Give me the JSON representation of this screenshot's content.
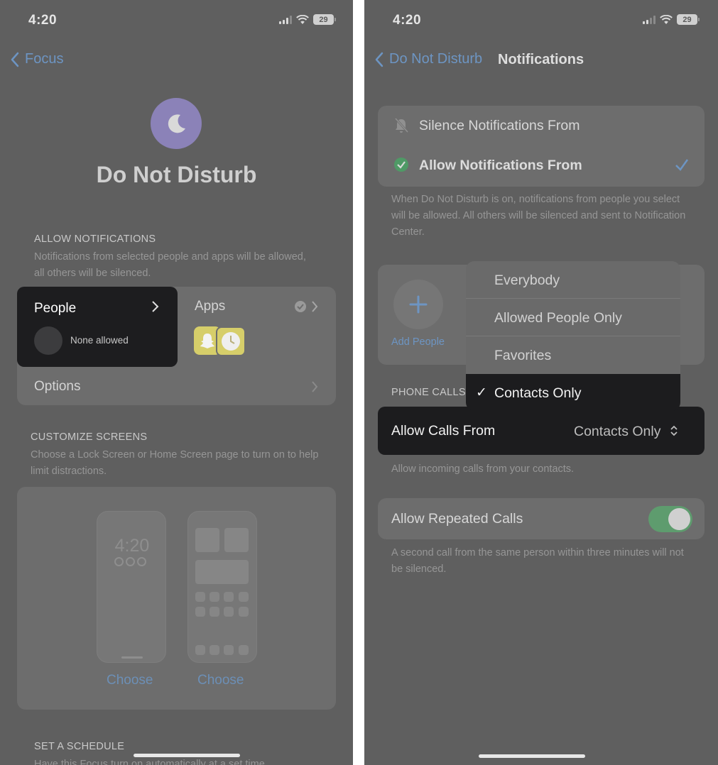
{
  "left": {
    "status": {
      "time": "4:20",
      "battery": "29"
    },
    "nav": {
      "back_label": "Focus"
    },
    "focus_title": "Do Not Disturb",
    "allow_notifications": {
      "header": "ALLOW NOTIFICATIONS",
      "description": "Notifications from selected people and apps will be allowed, all others will be silenced.",
      "people_label": "People",
      "people_status": "None allowed",
      "apps_label": "Apps",
      "options_label": "Options"
    },
    "customize_screens": {
      "header": "CUSTOMIZE SCREENS",
      "description": "Choose a Lock Screen or Home Screen page to turn on to help limit distractions.",
      "lock_preview_time": "4:20",
      "choose_lock": "Choose",
      "choose_home": "Choose"
    },
    "schedule": {
      "header": "SET A SCHEDULE",
      "description": "Have this Focus turn on automatically at a set time"
    }
  },
  "right": {
    "status": {
      "time": "4:20",
      "battery": "29"
    },
    "nav": {
      "back_label": "Do Not Disturb",
      "title": "Notifications"
    },
    "mode": {
      "silence_label": "Silence Notifications From",
      "allow_label": "Allow Notifications From",
      "description": "When Do Not Disturb is on, notifications from people you select will be allowed. All others will be silenced and sent to Notification Center."
    },
    "add_people_label": "Add People",
    "dropdown": {
      "options": [
        "Everybody",
        "Allowed People Only",
        "Favorites"
      ],
      "selected": "Contacts Only",
      "check": "✓"
    },
    "phone_calls": {
      "header": "PHONE CALLS",
      "allow_calls_label": "Allow Calls From",
      "allow_calls_value": "Contacts Only",
      "description": "Allow incoming calls from your contacts."
    },
    "repeated_calls": {
      "label": "Allow Repeated Calls",
      "enabled": true,
      "description": "A second call from the same person within three minutes will not be silenced."
    }
  },
  "colors": {
    "background": "#5f5f5f",
    "card": "#6d6d6d",
    "highlight": "#1c1c1e",
    "link": "#6d95c3",
    "toggle_on": "#5e9c6e",
    "focus_purple": "#8b82b8"
  }
}
